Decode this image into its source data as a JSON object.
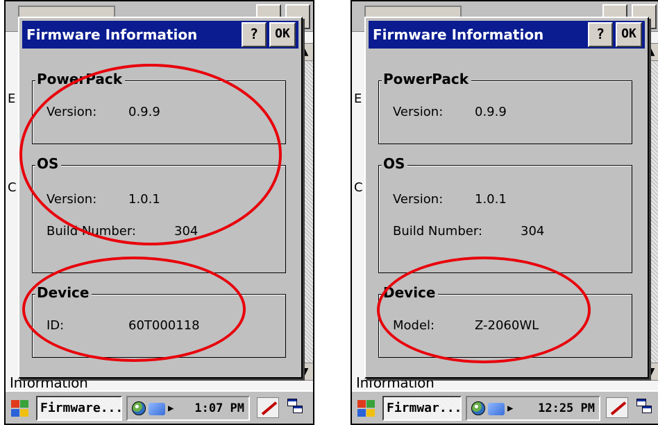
{
  "screens": [
    {
      "title": "Firmware Information",
      "help_label": "?",
      "ok_label": "OK",
      "powerpack": {
        "heading": "PowerPack",
        "version_label": "Version:",
        "version_value": "0.9.9"
      },
      "os": {
        "heading": "OS",
        "version_label": "Version:",
        "version_value": "1.0.1",
        "build_label": "Build Number:",
        "build_value": "304"
      },
      "device": {
        "heading": "Device",
        "field_label": "ID:",
        "field_value": "60T000118"
      },
      "background_label": "Information",
      "task_label": "Firmware...",
      "clock": "1:07 PM"
    },
    {
      "title": "Firmware Information",
      "help_label": "?",
      "ok_label": "OK",
      "powerpack": {
        "heading": "PowerPack",
        "version_label": "Version:",
        "version_value": "0.9.9"
      },
      "os": {
        "heading": "OS",
        "version_label": "Version:",
        "version_value": "1.0.1",
        "build_label": "Build Number:",
        "build_value": "304"
      },
      "device": {
        "heading": "Device",
        "field_label": "Model:",
        "field_value": "Z-2060WL"
      },
      "background_label": "Information",
      "task_label": "Firmwar...",
      "clock": "12:25 PM"
    }
  ],
  "bg_side_letters": [
    "E",
    "C"
  ],
  "annotation_color": "#e8000b"
}
